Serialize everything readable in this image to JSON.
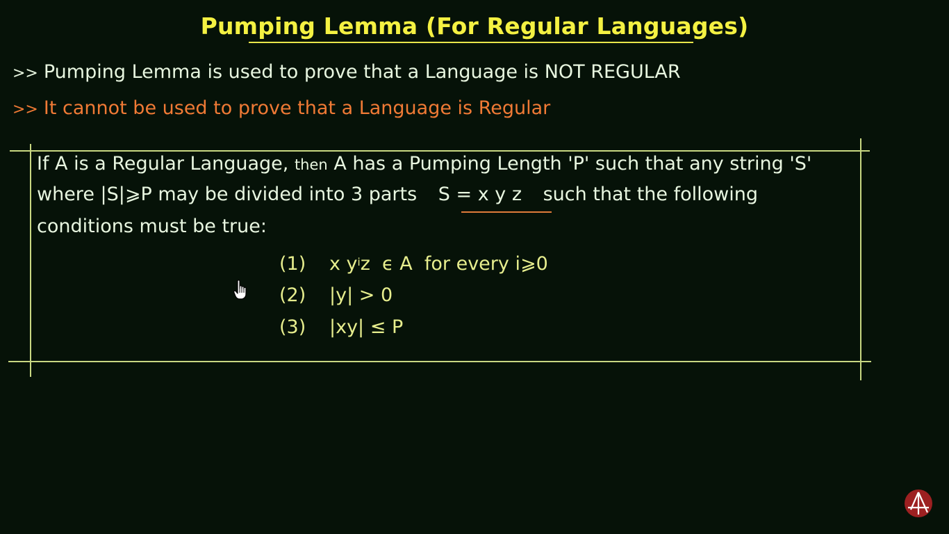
{
  "title": "Pumping Lemma (For Regular Languages)",
  "bullets": {
    "marker": ">>",
    "line1": "Pumping Lemma is used to prove that a Language is NOT REGULAR",
    "line2": "It cannot be used to prove that a Language is Regular"
  },
  "definition": {
    "line1_a": "If A is a Regular Language,",
    "line1_then": "then",
    "line1_b": "A has a Pumping Length 'P' such that any string 'S'",
    "line2_a": "where |S|⩾P may be divided into 3 parts",
    "line2_eq": "S = x y z",
    "line2_b": "such that the following",
    "line3": "conditions must be true:"
  },
  "conditions": [
    {
      "num": "(1)",
      "pre": "x y",
      "sup": "i",
      "post": "z  ϵ A  for every i⩾0"
    },
    {
      "num": "(2)",
      "expr": "|y| > 0"
    },
    {
      "num": "(3)",
      "expr": "|xy| ≤ P"
    }
  ],
  "colors": {
    "background": "#061208",
    "title": "#f4f142",
    "text": "#e8f6e0",
    "warning": "#f07a35",
    "conditions": "#e7ee8e",
    "box_lines": "#c9d882"
  },
  "icons": {
    "cursor": "hand-pointer-icon",
    "logo": "channel-logo-icon"
  }
}
